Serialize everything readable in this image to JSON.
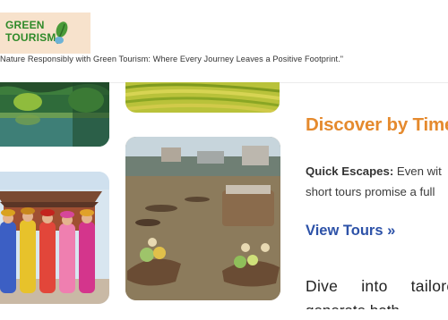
{
  "header": {
    "logo_text": "GREEN TOURISM",
    "tagline": "Nature Responsibly with Green Tourism: Where Every Journey Leaves a Positive Footprint.\""
  },
  "images": {
    "top_left": "river-landscape-photo",
    "top_middle": "rice-terrace-photo",
    "bottom_left": "ao-dai-women-photo",
    "bottom_middle": "floating-market-photo"
  },
  "section": {
    "heading": "Discover by Time",
    "quick_label": "Quick Escapes:",
    "quick_text_line1": " Even wit",
    "quick_text_line2": "short tours promise a full",
    "link_label": "View Tours »",
    "body_words": [
      "Dive",
      "into",
      "tailored"
    ],
    "body_line2": "generate both"
  },
  "colors": {
    "heading": "#e58a2e",
    "link": "#2d52a8",
    "logo_green": "#2f8a2a",
    "logo_bg": "#f7e2cc"
  }
}
